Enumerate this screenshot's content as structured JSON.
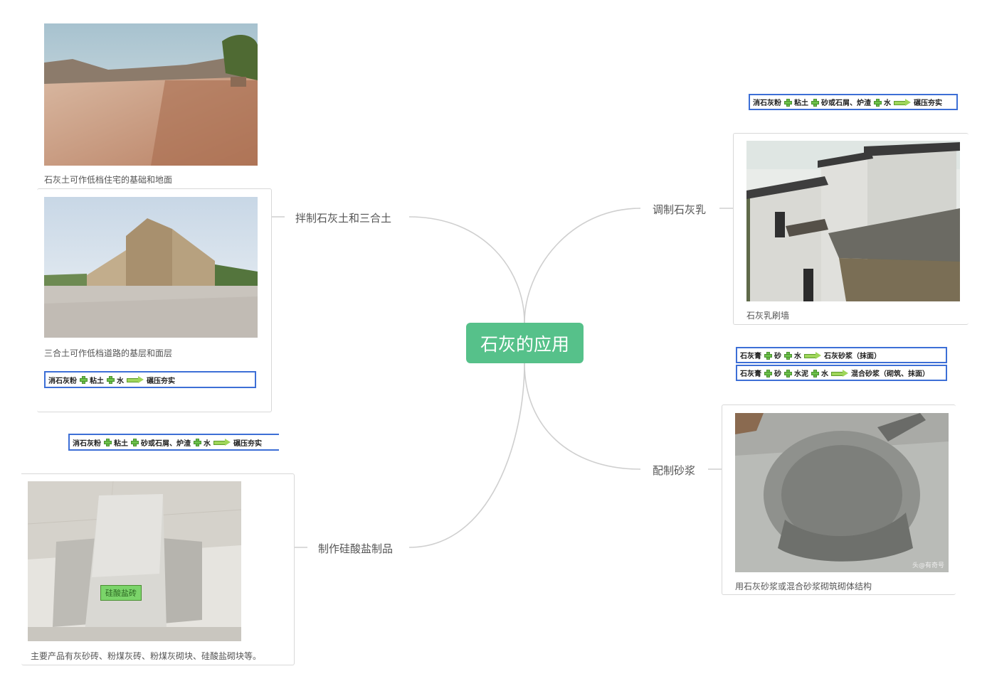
{
  "root": {
    "title": "石灰的应用"
  },
  "branches": {
    "mix": "拌制石灰土和三合土",
    "silicate": "制作硅酸盐制品",
    "milk": "调制石灰乳",
    "mortar": "配制砂浆"
  },
  "captions": {
    "road": "石灰土可作低档住宅的基础和地面",
    "building": "三合土可作低档道路的基层和面层",
    "brick": "主要产品有灰砂砖、粉煤灰砖、粉煤灰砌块、硅酸盐砌块等。",
    "house": "石灰乳刷墙",
    "mortar": "用石灰砂浆或混合砂浆砌筑砌体结构"
  },
  "formulas": {
    "f1": [
      "消石灰粉",
      "粘土",
      "水",
      "碾压夯实"
    ],
    "f2": [
      "消石灰粉",
      "粘土",
      "砂或石屑、炉渣",
      "水",
      "碾压夯实"
    ],
    "f3": [
      "消石灰粉",
      "粘土",
      "砂或石屑、炉渣",
      "水",
      "碾压夯实"
    ],
    "f4": [
      "石灰膏",
      "砂",
      "水",
      "石灰砂浆（抹面）"
    ],
    "f5": [
      "石灰膏",
      "砂",
      "水泥",
      "水",
      "混合砂浆（砌筑、抹面）"
    ]
  },
  "brick_label": "硅酸盐砖",
  "watermark": "头@有奇号",
  "colors": {
    "root": "#56c18a",
    "line": "#cccccc",
    "formula_border": "#3d6fd6"
  }
}
